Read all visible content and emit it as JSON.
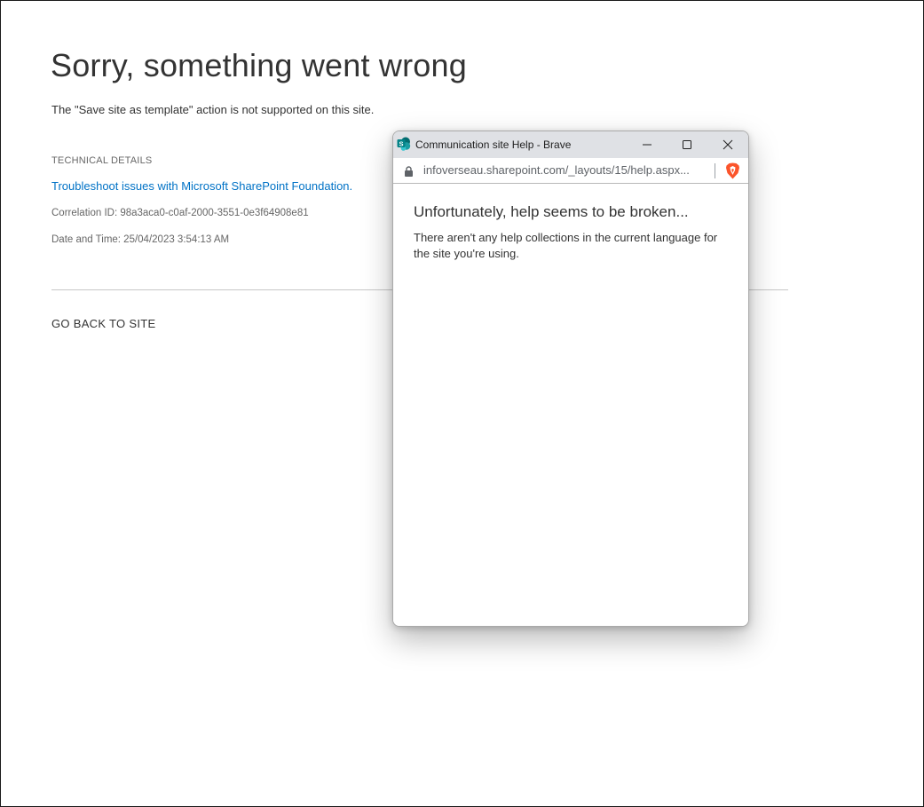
{
  "error_page": {
    "title": "Sorry, something went wrong",
    "message": "The \"Save site as template\" action is not supported on this site.",
    "technical_details_heading": "TECHNICAL DETAILS",
    "troubleshoot_link": "Troubleshoot issues with Microsoft SharePoint Foundation.",
    "correlation_id": "Correlation ID: 98a3aca0-c0af-2000-3551-0e3f64908e81",
    "date_time": "Date and Time: 25/04/2023 3:54:13 AM",
    "go_back_link": "GO BACK TO SITE"
  },
  "popup_window": {
    "title": "Communication site Help - Brave",
    "url": "infoverseau.sharepoint.com/_layouts/15/help.aspx...",
    "app_icon": "sharepoint-icon",
    "controls": [
      "minimize-icon",
      "maximize-icon",
      "close-icon"
    ],
    "help_heading": "Unfortunately, help seems to be broken...",
    "help_body": "There aren't any help collections in the current language for the site you're using."
  },
  "colors": {
    "link": "#0072c6",
    "text": "#333333",
    "muted": "#666666",
    "titlebar": "#dfe1e5",
    "sharepoint_teal": "#038387",
    "brave_orange": "#fb542b"
  }
}
